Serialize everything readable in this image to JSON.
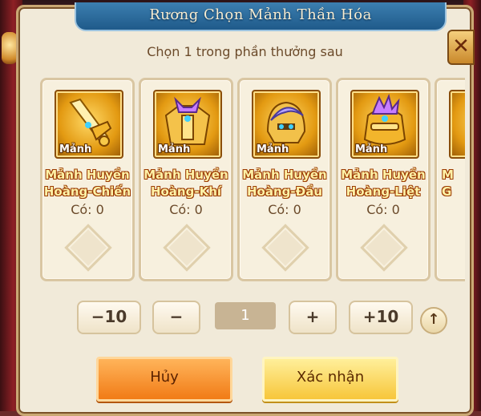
{
  "dialog": {
    "title": "Rương Chọn Mảnh Thần Hóa",
    "subtitle": "Chọn 1 trong phần thưởng sau",
    "close_icon": "close-icon"
  },
  "items": [
    {
      "badge": "Mảnh",
      "name_line1": "Mảnh Huyền",
      "name_line2": "Hoàng-Chiến",
      "owned": "Có: 0",
      "icon": "golden-sword-icon"
    },
    {
      "badge": "Mảnh",
      "name_line1": "Mảnh Huyền",
      "name_line2": "Hoàng-Khí",
      "owned": "Có: 0",
      "icon": "golden-armor-icon"
    },
    {
      "badge": "Mảnh",
      "name_line1": "Mảnh Huyền",
      "name_line2": "Hoàng-Đầu",
      "owned": "Có: 0",
      "icon": "golden-helmet-icon"
    },
    {
      "badge": "Mảnh",
      "name_line1": "Mảnh Huyền",
      "name_line2": "Hoàng-Liệt",
      "owned": "Có: 0",
      "icon": "golden-gauntlet-icon"
    },
    {
      "badge": "",
      "name_line1": "M",
      "name_line2": "G",
      "owned": "",
      "icon": "golden-item-icon"
    }
  ],
  "controls": {
    "minus10": "−10",
    "minus": "−",
    "quantity": "1",
    "plus": "+",
    "plus10": "+10",
    "up_icon": "arrow-up-icon"
  },
  "buttons": {
    "cancel": "Hủy",
    "confirm": "Xác nhận"
  },
  "colors": {
    "panel_bg": "#f1ead9",
    "title_bar": "#2c6e9f",
    "item_name": "#fff2a8",
    "cancel_btn": "#f58a26",
    "confirm_btn": "#f8d24c"
  }
}
